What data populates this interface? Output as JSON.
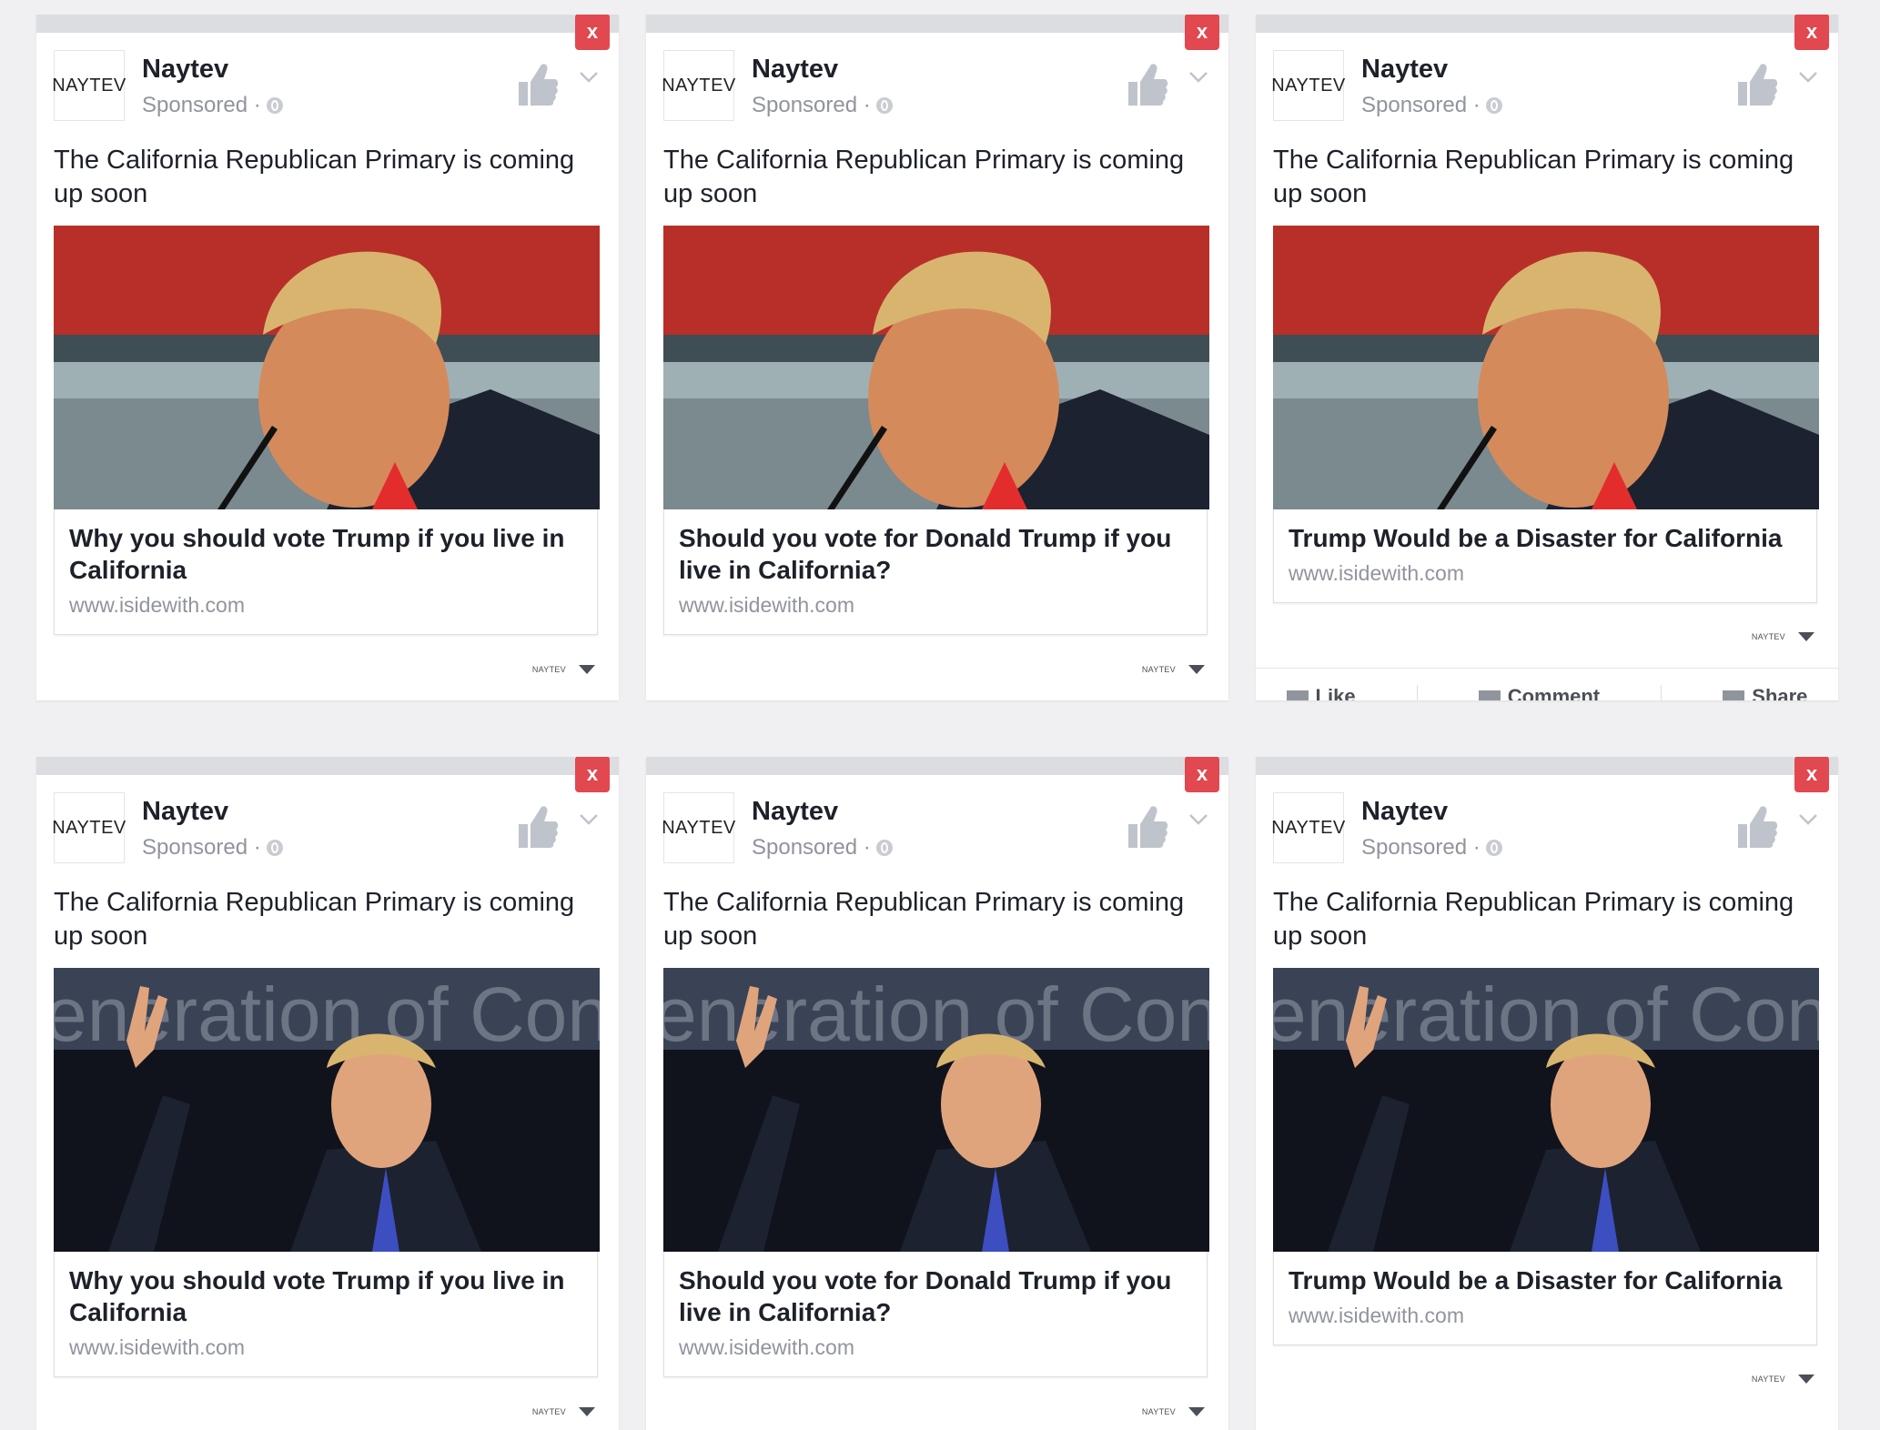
{
  "ads": [
    {
      "brand": "Naytev",
      "logo_text": "NAYTEV",
      "sponsored": "Sponsored ·",
      "close": "x",
      "text": "The California Republican Primary is coming up soon",
      "headline": "Why you should vote Trump if you live in California",
      "url": "www.isidewith.com",
      "footer_logo": "NAYTEV",
      "image": "debate-photo"
    },
    {
      "brand": "Naytev",
      "logo_text": "NAYTEV",
      "sponsored": "Sponsored ·",
      "close": "x",
      "text": "The California Republican Primary is coming up soon",
      "headline": "Should you vote for Donald Trump if you live in California?",
      "url": "www.isidewith.com",
      "footer_logo": "NAYTEV",
      "image": "debate-photo"
    },
    {
      "brand": "Naytev",
      "logo_text": "NAYTEV",
      "sponsored": "Sponsored ·",
      "close": "x",
      "text": "The California Republican Primary is coming up soon",
      "headline": "Trump Would be a Disaster for California",
      "url": "www.isidewith.com",
      "footer_logo": "NAYTEV",
      "image": "debate-photo",
      "actions": [
        "Like",
        "Comment",
        "Share"
      ]
    },
    {
      "brand": "Naytev",
      "logo_text": "NAYTEV",
      "sponsored": "Sponsored ·",
      "close": "x",
      "text": "The California Republican Primary is coming up soon",
      "headline": "Why you should vote Trump if you live in California",
      "url": "www.isidewith.com",
      "footer_logo": "NAYTEV",
      "image": "peace-sign-photo"
    },
    {
      "brand": "Naytev",
      "logo_text": "NAYTEV",
      "sponsored": "Sponsored ·",
      "close": "x",
      "text": "The California Republican Primary is coming up soon",
      "headline": "Should you vote for Donald Trump if you live in California?",
      "url": "www.isidewith.com",
      "footer_logo": "NAYTEV",
      "image": "peace-sign-photo"
    },
    {
      "brand": "Naytev",
      "logo_text": "NAYTEV",
      "sponsored": "Sponsored ·",
      "close": "x",
      "text": "The California Republican Primary is coming up soon",
      "headline": "Trump Would be a Disaster for California",
      "url": "www.isidewith.com",
      "footer_logo": "NAYTEV",
      "image": "peace-sign-photo"
    }
  ],
  "backdrop_text": "eneration of Conse",
  "colors": {
    "close": "#e2484f",
    "thumb": "#bfc3cc",
    "text": "#1d2129",
    "muted": "#90949c"
  }
}
